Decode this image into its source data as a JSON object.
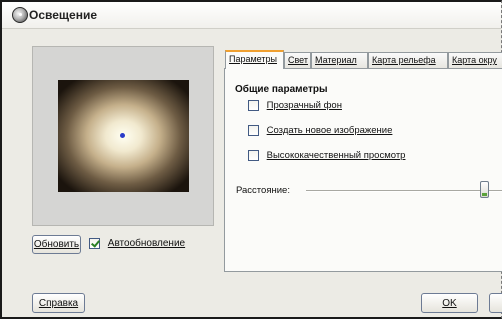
{
  "window": {
    "title": "Освещение"
  },
  "preview": {
    "refresh_label": "Обновить",
    "auto_update": {
      "label": "Автообновление",
      "checked": true
    }
  },
  "tabs": [
    {
      "label": "Параметры",
      "active": true
    },
    {
      "label": "Свет",
      "active": false
    },
    {
      "label": "Материал",
      "active": false
    },
    {
      "label": "Карта рельефа",
      "active": false
    },
    {
      "label": "Карта окру",
      "active": false
    }
  ],
  "general": {
    "title": "Общие параметры",
    "options": [
      {
        "label": "Прозрачный фон",
        "checked": false
      },
      {
        "label": "Создать новое изображение",
        "checked": false
      },
      {
        "label": "Высококачественный просмотр",
        "checked": false
      }
    ],
    "distance": {
      "label": "Расстояние:",
      "value_fraction": 0.85
    }
  },
  "footer": {
    "help_label": "Справка",
    "ok_label": "OK"
  },
  "colors": {
    "active_tab_accent": "#f0a030",
    "light_point": "#2b3cc8",
    "checkmark": "#2a7f24"
  }
}
